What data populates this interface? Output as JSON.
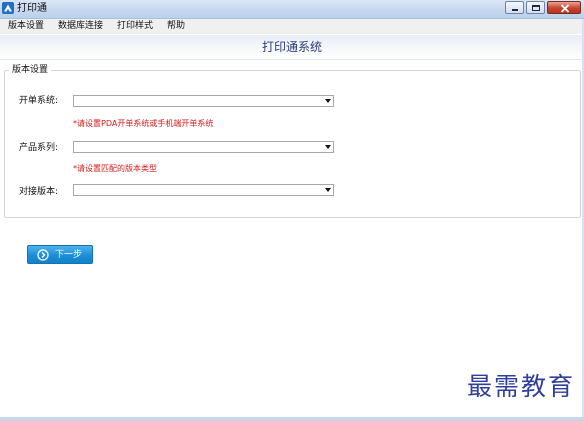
{
  "window": {
    "title": "打印通",
    "controls": {
      "minimize_icon": "minimize-icon",
      "maximize_icon": "maximize-icon",
      "close_icon": "close-icon"
    }
  },
  "menu": {
    "items": [
      {
        "label": "版本设置"
      },
      {
        "label": "数据库连接"
      },
      {
        "label": "打印样式"
      },
      {
        "label": "帮助"
      }
    ]
  },
  "header": {
    "title": "打印通系统"
  },
  "group": {
    "legend": "版本设置",
    "fields": [
      {
        "label": "开单系统:",
        "value": "",
        "hint": "*请设置PDA开单系统或手机端开单系统"
      },
      {
        "label": "产品系列:",
        "value": "",
        "hint": "*请设置匹配的版本类型"
      },
      {
        "label": "对接版本:",
        "value": "",
        "hint": ""
      }
    ]
  },
  "actions": {
    "next_label": "下一步"
  },
  "watermark": {
    "text": "最需教育"
  },
  "colors": {
    "accent": "#1c8fd8",
    "hint": "#d21a1a",
    "header_title": "#2a3d7a",
    "watermark": "#2f3f9a"
  }
}
